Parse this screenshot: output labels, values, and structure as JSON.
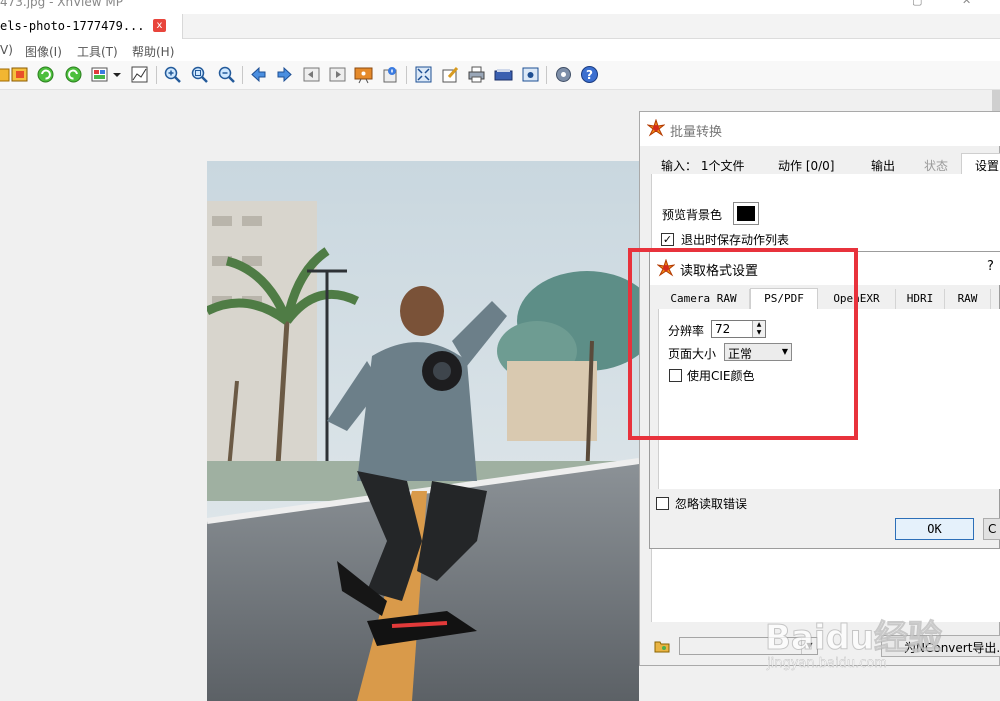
{
  "window": {
    "title": "473.jpg - XnView MP"
  },
  "tab": {
    "label": "els-photo-1777479...",
    "close": "x"
  },
  "menu": {
    "items": [
      "V)",
      "图像(I)",
      "工具(T)",
      "帮助(H)"
    ]
  },
  "toolbar_icons": [
    "open-icon",
    "browse-icon",
    "rotate-left-icon",
    "rotate-right-icon",
    "color-adjust-icon",
    "dropdown-icon",
    "levels-icon",
    "zoom-in-icon",
    "zoom-fit-icon",
    "zoom-out-icon",
    "prev-icon",
    "next-icon",
    "first-icon",
    "last-icon",
    "slideshow-icon",
    "info-icon",
    "fullscreen-icon",
    "edit-icon",
    "print-icon",
    "scanner-icon",
    "capture-icon",
    "settings-icon",
    "help-icon"
  ],
  "batch_dialog": {
    "title": "批量转换",
    "tabs": [
      {
        "label": "输入： 1个文件",
        "state": "normal"
      },
      {
        "label": "动作 [0/0]",
        "state": "normal"
      },
      {
        "label": "输出",
        "state": "normal"
      },
      {
        "label": "状态",
        "state": "disabled"
      },
      {
        "label": "设置",
        "state": "active"
      }
    ],
    "preview_bg_label": "预览背景色",
    "preview_bg_color": "#000000",
    "save_actions_label": "退出时保存动作列表",
    "save_actions_checked": true,
    "ignore_errors_label": "忽略读取错误",
    "ignore_errors_checked": false,
    "export_label": "为NConvert导出..."
  },
  "format_dialog": {
    "title": "读取格式设置",
    "help": "?",
    "tabs": [
      {
        "label": "Camera RAW",
        "active": false
      },
      {
        "label": "PS/PDF",
        "active": true
      },
      {
        "label": "OpenEXR",
        "active": false
      },
      {
        "label": "HDRI",
        "active": false
      },
      {
        "label": "RAW",
        "active": false
      }
    ],
    "resolution_label": "分辨率",
    "resolution_value": "72",
    "page_size_label": "页面大小",
    "page_size_value": "正常",
    "cie_label": "使用CIE颜色",
    "cie_checked": false,
    "ok_label": "OK",
    "cancel_stub": "C"
  },
  "watermark": {
    "text": "Baidu经验",
    "url": "jingyan.baidu.com"
  },
  "colors": {
    "highlight": "#e8323c",
    "ok_border": "#2c6fb8",
    "close_red": "#e8453c"
  }
}
